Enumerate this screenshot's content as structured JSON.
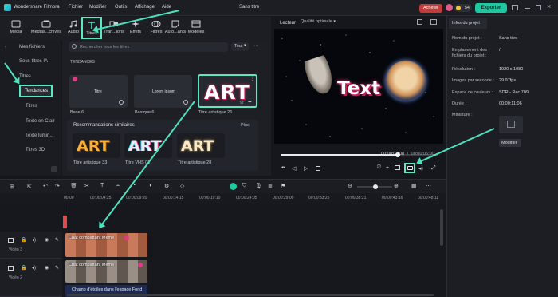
{
  "app": {
    "name": "Wondershare Filmora",
    "project_title": "Sans titre",
    "buy_label": "Acheter",
    "credits": "54",
    "export_label": "Exporter",
    "menu": [
      "Fichier",
      "Modifier",
      "Outils",
      "Affichage",
      "Aide"
    ]
  },
  "toolbar": {
    "tabs": [
      {
        "label": "Média",
        "icon": "media-icon"
      },
      {
        "label": "Médias...chives",
        "icon": "stock-media-icon"
      },
      {
        "label": "Audio",
        "icon": "music-icon"
      },
      {
        "label": "Titres",
        "icon": "text-t-icon"
      },
      {
        "label": "Tran...ions",
        "icon": "transition-icon"
      },
      {
        "label": "Effets",
        "icon": "sparkle-icon"
      },
      {
        "label": "Filtres",
        "icon": "filter-icon"
      },
      {
        "label": "Auto...ants",
        "icon": "sticker-icon"
      },
      {
        "label": "Modèles",
        "icon": "template-icon"
      }
    ]
  },
  "sidebar": {
    "items": [
      {
        "label": "Mes fichiers"
      },
      {
        "label": "Sous-titres IA"
      },
      {
        "label": "Titres"
      },
      {
        "label": "Tendances"
      },
      {
        "label": "Titres"
      },
      {
        "label": "Texte en Clair"
      },
      {
        "label": "Texte lumin..."
      },
      {
        "label": "Titres 3D"
      }
    ]
  },
  "library": {
    "search_placeholder": "Rechercher tous les titres",
    "filter_label": "Tout",
    "section_title": "TENDANCES",
    "cards": [
      {
        "name": "Base 6",
        "preview": "Titre"
      },
      {
        "name": "Basique 6",
        "preview": "Lorem ipsum"
      },
      {
        "name": "Titre artistique 26",
        "preview": "ART"
      }
    ],
    "recommend_title": "Recommandations similaires",
    "recommend_more": "Plus",
    "recommend_cards": [
      {
        "name": "Titre artistique 33",
        "preview": "ART"
      },
      {
        "name": "Titre VHS 01",
        "preview": "ART"
      },
      {
        "name": "Titre artistique 28",
        "preview": "ART"
      }
    ]
  },
  "player": {
    "label": "Lecteur",
    "quality": "Qualité optimale",
    "overlay_text": "Text",
    "current_time": "00:00:04:08",
    "separator": "/",
    "total_time": "00:00:06:00",
    "progress": 0.74
  },
  "project_info": {
    "tab_label": "Infos du projet",
    "rows": [
      {
        "label": "Nom du projet :",
        "value": "Sans titre"
      },
      {
        "label": "Emplacement des fichiers du projet :",
        "value": "/"
      },
      {
        "label": "Résolution :",
        "value": "1920 x 1080"
      },
      {
        "label": "Images par seconde :",
        "value": "29.97fps"
      },
      {
        "label": "Espace de couleurs :",
        "value": "SDR - Rec.709"
      },
      {
        "label": "Durée :",
        "value": "00:00:11:06"
      }
    ],
    "thumbnail_label": "Miniature :",
    "modify_label": "Modifier"
  },
  "timeline": {
    "ruler_ticks": [
      "00:00",
      "00:00:04:25",
      "00:00:09:20",
      "00:00:14:15",
      "00:00:19:10",
      "00:00:24:05",
      "00:00:29:00",
      "00:00:33:25",
      "00:00:38:21",
      "00:00:43:16",
      "00:00:48:11"
    ],
    "tracks": [
      {
        "label": "Vidéo 3",
        "clip": "Chat combattant Meme"
      },
      {
        "label": "Vidéo 2",
        "clip": "Chat combattant Meme"
      },
      {
        "label": "",
        "clip": "Champ d'étoiles dans l'espace Fond"
      }
    ]
  },
  "colors": {
    "accent": "#4fe0bd",
    "export": "#1fc8a0",
    "buy": "#c23b3b"
  }
}
